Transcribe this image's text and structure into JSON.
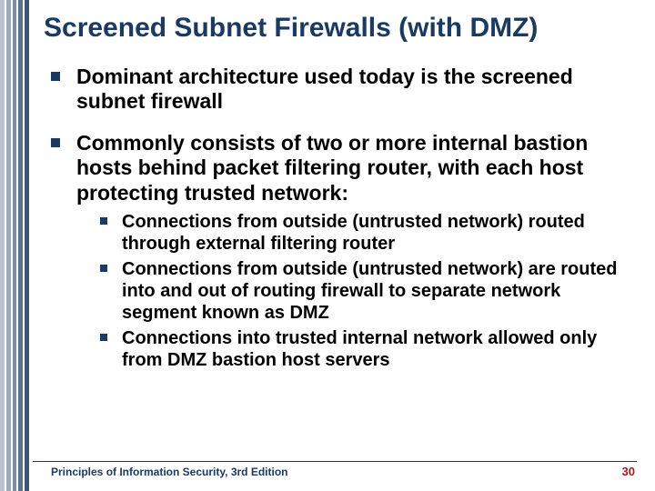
{
  "title": "Screened Subnet Firewalls (with DMZ)",
  "bullets": [
    {
      "text": "Dominant architecture used today is the screened subnet firewall",
      "sub": []
    },
    {
      "text": "Commonly consists of two or more internal bastion hosts behind packet filtering router, with each host protecting trusted network:",
      "sub": [
        "Connections from outside (untrusted network) routed through external filtering router",
        "Connections from outside (untrusted network) are routed into and out of routing firewall to separate network segment known as DMZ",
        "Connections into trusted internal network allowed only from DMZ bastion host servers"
      ]
    }
  ],
  "footer": "Principles of Information Security, 3rd Edition",
  "page": "30"
}
